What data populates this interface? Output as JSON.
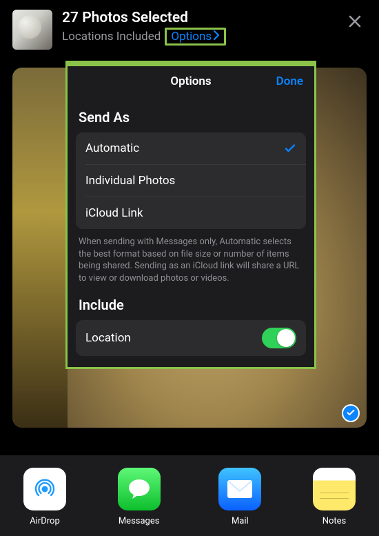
{
  "header": {
    "title": "27 Photos Selected",
    "subtitle": "Locations Included",
    "options_label": "Options"
  },
  "options_panel": {
    "title": "Options",
    "done_label": "Done",
    "send_as_label": "Send As",
    "send_as_options": {
      "automatic": "Automatic",
      "individual": "Individual Photos",
      "icloud": "iCloud Link"
    },
    "send_as_footer": "When sending with Messages only, Automatic selects the best format based on file size or number of items being shared. Sending as an iCloud link will share a URL to view or download photos or videos.",
    "include_label": "Include",
    "include_location_label": "Location",
    "include_location_on": true
  },
  "share_targets": {
    "airdrop": "AirDrop",
    "messages": "Messages",
    "mail": "Mail",
    "notes": "Notes"
  }
}
